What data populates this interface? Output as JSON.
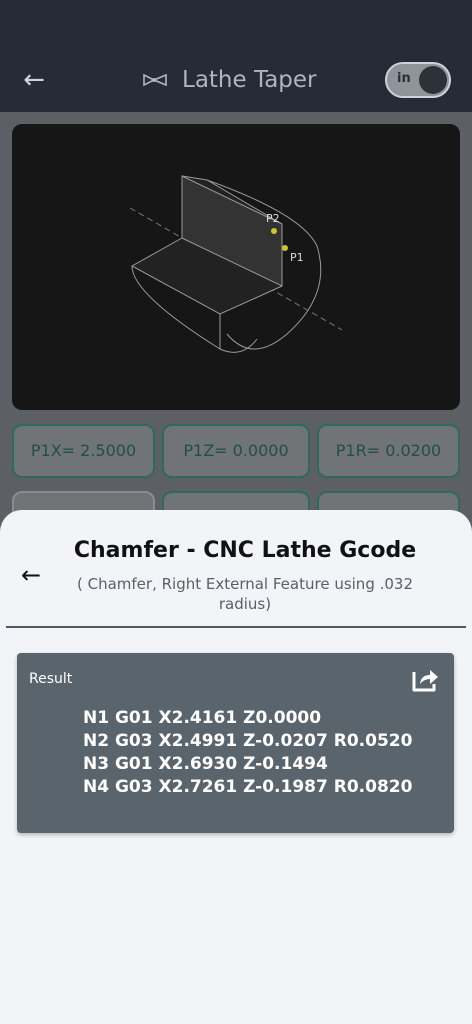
{
  "appbar": {
    "title": "Lathe Taper",
    "toggle_label": "in"
  },
  "diagram": {
    "p1_label": "P1",
    "p2_label": "P2"
  },
  "params": [
    {
      "label": "P1X= 2.5000"
    },
    {
      "label": "P1Z= 0.0000"
    },
    {
      "label": "P1R= 0.0200"
    }
  ],
  "sheet": {
    "title": "Chamfer - CNC Lathe Gcode",
    "subtitle": "( Chamfer, Right External Feature using .032 radius)",
    "result_label": "Result",
    "gcode": [
      "N1 G01 X2.4161 Z0.0000",
      "N2 G03 X2.4991 Z-0.0207 R0.0520",
      "N3 G01 X2.6930 Z-0.1494",
      "N4 G03 X2.7261 Z-0.1987 R0.0820"
    ]
  },
  "colors": {
    "accent": "#2d6a5f",
    "result_bg": "#5a646c",
    "sheet_bg": "#f2f4f8"
  }
}
